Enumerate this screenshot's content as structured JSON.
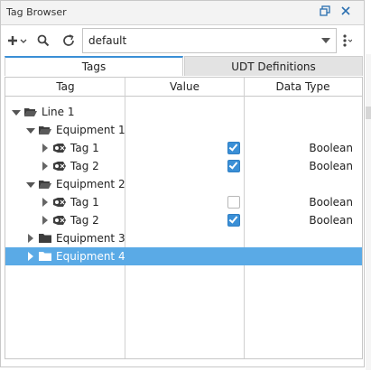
{
  "window": {
    "title": "Tag Browser",
    "icons": [
      "restore-icon",
      "close-icon"
    ]
  },
  "toolbar": {
    "add_icon": "plus-icon",
    "search_icon": "search-icon",
    "refresh_icon": "refresh-icon",
    "provider_value": "default",
    "menu_icon": "kebab-menu-icon"
  },
  "tabs": [
    {
      "label": "Tags",
      "active": true
    },
    {
      "label": "UDT Definitions",
      "active": false
    }
  ],
  "columns": [
    "Tag",
    "Value",
    "Data Type"
  ],
  "rows": [
    {
      "name": "Line 1",
      "level": 0,
      "kind": "folder-open",
      "expander": "down",
      "value": null,
      "type": ""
    },
    {
      "name": "Equipment 1",
      "level": 1,
      "kind": "folder-open",
      "expander": "down",
      "value": null,
      "type": ""
    },
    {
      "name": "Tag 1",
      "level": 2,
      "kind": "tag",
      "expander": "right",
      "value": true,
      "type": "Boolean"
    },
    {
      "name": "Tag 2",
      "level": 2,
      "kind": "tag",
      "expander": "right",
      "value": true,
      "type": "Boolean"
    },
    {
      "name": "Equipment 2",
      "level": 1,
      "kind": "folder-open",
      "expander": "down",
      "value": null,
      "type": ""
    },
    {
      "name": "Tag 1",
      "level": 2,
      "kind": "tag",
      "expander": "right",
      "value": false,
      "type": "Boolean"
    },
    {
      "name": "Tag 2",
      "level": 2,
      "kind": "tag",
      "expander": "right",
      "value": true,
      "type": "Boolean"
    },
    {
      "name": "Equipment 3",
      "level": 1,
      "kind": "folder",
      "expander": "right",
      "value": null,
      "type": ""
    },
    {
      "name": "Equipment 4",
      "level": 1,
      "kind": "folder",
      "expander": "right",
      "value": null,
      "type": "",
      "selected": true
    }
  ],
  "colors": {
    "accent": "#3a8fd6",
    "selection": "#5aaae6",
    "icon": "#444444"
  }
}
